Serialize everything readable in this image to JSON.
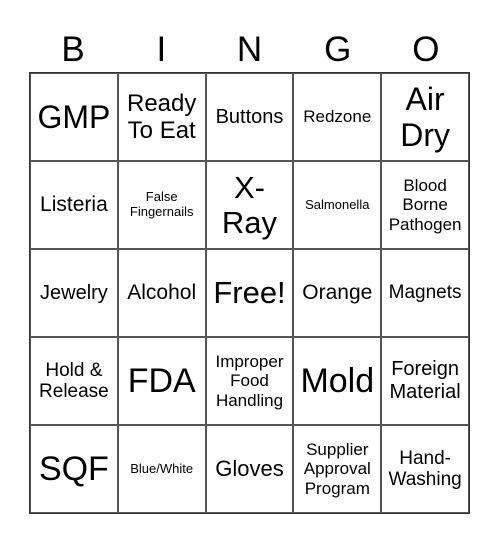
{
  "header": [
    "B",
    "I",
    "N",
    "G",
    "O"
  ],
  "cells": [
    {
      "text": "GMP",
      "size": 32
    },
    {
      "text": "Ready To Eat",
      "size": 24
    },
    {
      "text": "Buttons",
      "size": 20
    },
    {
      "text": "Redzone",
      "size": 17
    },
    {
      "text": "Air Dry",
      "size": 32
    },
    {
      "text": "Listeria",
      "size": 21
    },
    {
      "text": "False Fingernails",
      "size": 13
    },
    {
      "text": "X-Ray",
      "size": 31
    },
    {
      "text": "Salmonella",
      "size": 13
    },
    {
      "text": "Blood Borne Pathogen",
      "size": 17
    },
    {
      "text": "Jewelry",
      "size": 20
    },
    {
      "text": "Alcohol",
      "size": 21
    },
    {
      "text": "Free!",
      "size": 31
    },
    {
      "text": "Orange",
      "size": 21
    },
    {
      "text": "Magnets",
      "size": 19
    },
    {
      "text": "Hold & Release",
      "size": 19
    },
    {
      "text": "FDA",
      "size": 34
    },
    {
      "text": "Improper Food Handling",
      "size": 17
    },
    {
      "text": "Mold",
      "size": 34
    },
    {
      "text": "Foreign Material",
      "size": 20
    },
    {
      "text": "SQF",
      "size": 34
    },
    {
      "text": "Blue/White",
      "size": 13
    },
    {
      "text": "Gloves",
      "size": 22
    },
    {
      "text": "Supplier Approval Program",
      "size": 17
    },
    {
      "text": "Hand-Washing",
      "size": 19
    }
  ]
}
